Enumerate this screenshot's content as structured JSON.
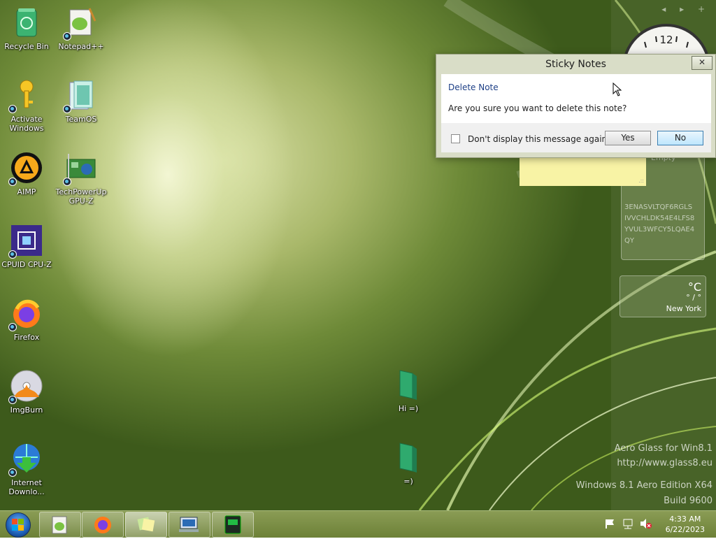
{
  "desktop_icons": [
    {
      "label": "Recycle Bin",
      "icon": "recycle-bin-icon"
    },
    {
      "label": "Notepad++",
      "icon": "notepad-plus-plus-icon"
    },
    {
      "label": "Activate Windows",
      "icon": "key-icon"
    },
    {
      "label": "TeamOS",
      "icon": "teamos-icon"
    },
    {
      "label": "AIMP",
      "icon": "aimp-icon"
    },
    {
      "label": "TechPowerUp GPU-Z",
      "icon": "gpuz-icon"
    },
    {
      "label": "CPUID CPU-Z",
      "icon": "cpuz-icon"
    },
    {
      "label": "Firefox",
      "icon": "firefox-icon"
    },
    {
      "label": "ImgBurn",
      "icon": "imgburn-icon"
    },
    {
      "label": "Internet Downlo...",
      "icon": "internet-download-manager-icon"
    },
    {
      "label": "Hi =)",
      "icon": "folder-icon"
    },
    {
      "label": "=)",
      "icon": "folder-icon"
    }
  ],
  "gadgets": {
    "clock": {
      "number": "12"
    },
    "partial_text": "Empty",
    "key_text": [
      "3ENASVLTQF6RGLS",
      "IVVCHLDK54E4LFS8",
      "YVUL3WFCY5LQAE4",
      "QY"
    ],
    "weather": {
      "unit": "°C",
      "range": "° / °",
      "city": "New York"
    }
  },
  "dialog": {
    "title": "Sticky Notes",
    "close_glyph": "✕",
    "heading": "Delete Note",
    "message": "Are you sure you want to delete this note?",
    "checkbox_label": "Don't display this message again",
    "yes_label": "Yes",
    "no_label": "No"
  },
  "watermark": {
    "line1": "Aero Glass for Win8.1",
    "line2": "http://www.glass8.eu",
    "line3": "Windows 8.1 Aero Edition X64",
    "line4": "Build 9600"
  },
  "taskbar": {
    "apps": [
      "notepad-plus-plus-icon",
      "firefox-icon",
      "sticky-notes-icon",
      "network-computer-icon",
      "gpu-monitor-icon"
    ],
    "tray_icons": [
      "flag-icon",
      "network-icon",
      "volume-muted-icon"
    ],
    "time": "4:33 AM",
    "date": "6/22/2023"
  },
  "colors": {
    "accent": "#1d3f86",
    "note": "#f8f3a5",
    "taskbar": "#7a8f45"
  }
}
